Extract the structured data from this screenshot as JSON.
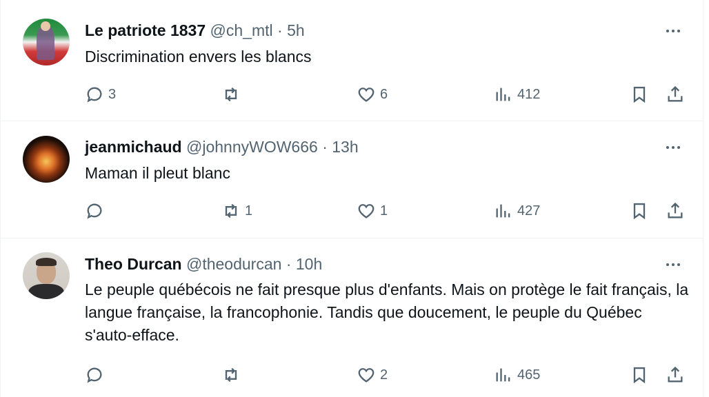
{
  "tweets": [
    {
      "name": "Le patriote 1837",
      "handle": "@ch_mtl",
      "sep": "·",
      "time": "5h",
      "text": "Discrimination envers les blancs",
      "replies": "3",
      "reposts": "",
      "likes": "6",
      "views": "412"
    },
    {
      "name": "jeanmichaud",
      "handle": "@johnnyWOW666",
      "sep": "·",
      "time": "13h",
      "text": "Maman il pleut blanc",
      "replies": "",
      "reposts": "1",
      "likes": "1",
      "views": "427"
    },
    {
      "name": "Theo Durcan",
      "handle": "@theodurcan",
      "sep": "·",
      "time": "10h",
      "text": "Le peuple québécois ne fait presque plus d'enfants. Mais on protège le fait français, la langue française, la francophonie. Tandis que doucement, le peuple du Québec s'auto-efface.",
      "replies": "",
      "reposts": "",
      "likes": "2",
      "views": "465"
    }
  ],
  "icons": {
    "reply": "reply-icon",
    "repost": "repost-icon",
    "like": "heart-icon",
    "views": "views-icon",
    "bookmark": "bookmark-icon",
    "share": "share-icon",
    "more": "more-icon"
  },
  "colors": {
    "text": "#0f1419",
    "secondary": "#536471",
    "divider": "#eff3f4"
  }
}
